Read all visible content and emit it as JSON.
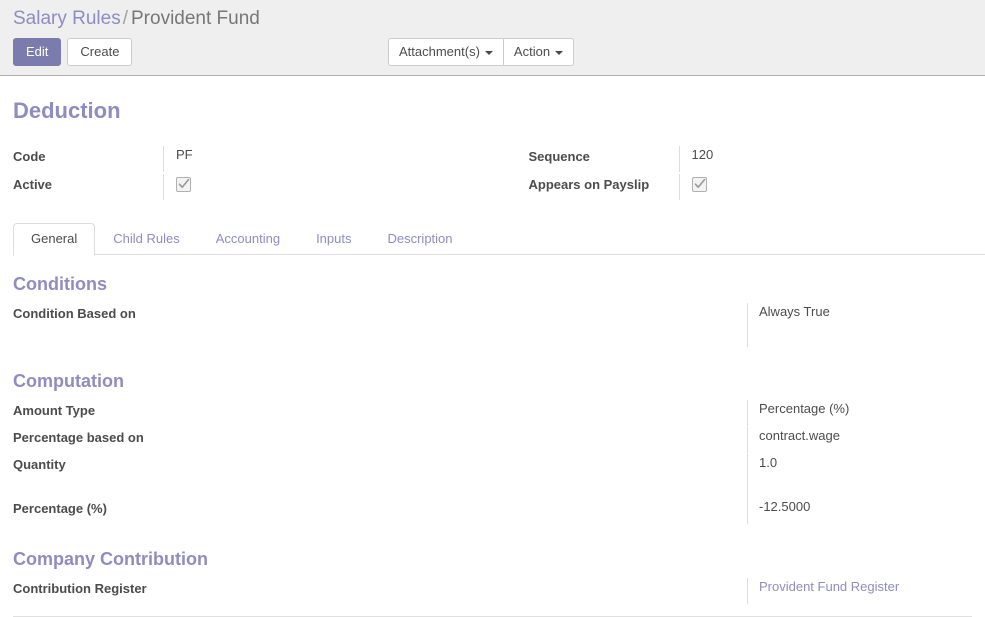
{
  "breadcrumb": {
    "parent": "Salary Rules",
    "separator": "/",
    "current": "Provident Fund"
  },
  "toolbar": {
    "edit_label": "Edit",
    "create_label": "Create",
    "attachments_label": "Attachment(s)",
    "action_label": "Action"
  },
  "form": {
    "title": "Deduction",
    "fields": {
      "code": {
        "label": "Code",
        "value": "PF"
      },
      "active": {
        "label": "Active",
        "checked": true
      },
      "sequence": {
        "label": "Sequence",
        "value": "120"
      },
      "appears_on_payslip": {
        "label": "Appears on Payslip",
        "checked": true
      }
    }
  },
  "tabs": [
    {
      "label": "General",
      "active": true
    },
    {
      "label": "Child Rules",
      "active": false
    },
    {
      "label": "Accounting",
      "active": false
    },
    {
      "label": "Inputs",
      "active": false
    },
    {
      "label": "Description",
      "active": false
    }
  ],
  "general": {
    "conditions": {
      "title": "Conditions",
      "condition_based_on": {
        "label": "Condition Based on",
        "value": "Always True"
      }
    },
    "computation": {
      "title": "Computation",
      "amount_type": {
        "label": "Amount Type",
        "value": "Percentage (%)"
      },
      "percentage_based_on": {
        "label": "Percentage based on",
        "value": "contract.wage"
      },
      "quantity": {
        "label": "Quantity",
        "value": "1.0"
      },
      "percentage": {
        "label": "Percentage (%)",
        "value": "-12.5000"
      }
    },
    "company_contribution": {
      "title": "Company Contribution",
      "contribution_register": {
        "label": "Contribution Register",
        "value": "Provident Fund Register"
      }
    }
  },
  "colors": {
    "accent": "#8f8cc0",
    "primary_button": "#7c7bad",
    "header_bg": "#efefef",
    "text": "#4c4c4c"
  }
}
